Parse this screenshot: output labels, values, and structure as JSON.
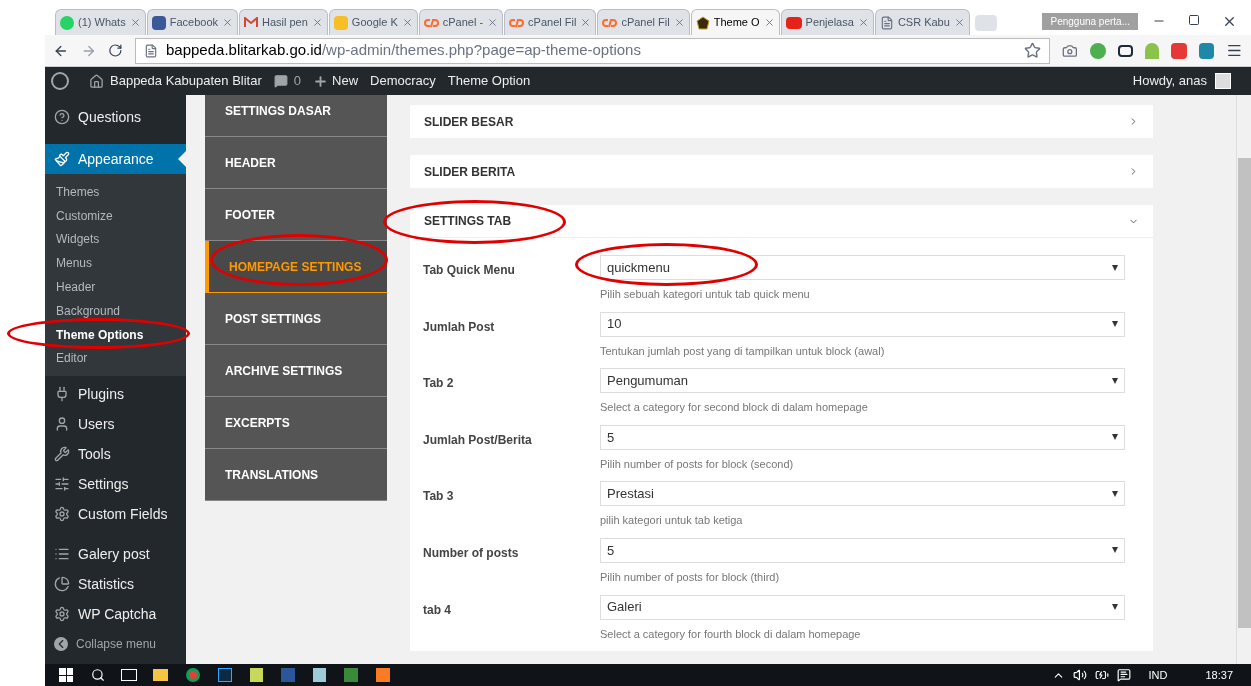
{
  "browser": {
    "tabs": [
      {
        "title": "(1) Whats",
        "selected": false
      },
      {
        "title": "Facebook",
        "selected": false
      },
      {
        "title": "Hasil pen",
        "selected": false
      },
      {
        "title": "Google K",
        "selected": false
      },
      {
        "title": "cPanel - ",
        "selected": false
      },
      {
        "title": "cPanel Fil",
        "selected": false
      },
      {
        "title": "cPanel Fil",
        "selected": false
      },
      {
        "title": "Theme O",
        "selected": true
      },
      {
        "title": "Penjelasa",
        "selected": false
      },
      {
        "title": "CSR Kabu",
        "selected": false
      }
    ],
    "profile": "Pengguna perta...",
    "url": {
      "domain": "bappeda.blitarkab.go.id",
      "path": "/wp-admin/themes.php?page=ap-theme-options"
    }
  },
  "admin_bar": {
    "site": "Bappeda Kabupaten Blitar",
    "comments": "0",
    "new": "New",
    "links": [
      "Democracy",
      "Theme Option"
    ],
    "greeting": "Howdy, anas"
  },
  "sidebar": {
    "items": [
      {
        "label": "Questions",
        "selected": false
      },
      {
        "label": "Appearance",
        "selected": true,
        "children": [
          {
            "label": "Themes",
            "selected": false
          },
          {
            "label": "Customize",
            "selected": false
          },
          {
            "label": "Widgets",
            "selected": false
          },
          {
            "label": "Menus",
            "selected": false
          },
          {
            "label": "Header",
            "selected": false
          },
          {
            "label": "Background",
            "selected": false
          },
          {
            "label": "Theme Options",
            "selected": true
          },
          {
            "label": "Editor",
            "selected": false
          }
        ]
      },
      {
        "label": "Plugins",
        "selected": false
      },
      {
        "label": "Users",
        "selected": false
      },
      {
        "label": "Tools",
        "selected": false
      },
      {
        "label": "Settings",
        "selected": false
      },
      {
        "label": "Custom Fields",
        "selected": false
      },
      {
        "label": "Galery post",
        "selected": false
      },
      {
        "label": "Statistics",
        "selected": false
      },
      {
        "label": "WP Captcha",
        "selected": false
      }
    ],
    "collapse": "Collapse menu"
  },
  "options_nav": [
    {
      "label": "SETTINGS DASAR",
      "selected": false
    },
    {
      "label": "HEADER",
      "selected": false
    },
    {
      "label": "FOOTER",
      "selected": false
    },
    {
      "label": "HOMEPAGE SETTINGS",
      "selected": true
    },
    {
      "label": "POST SETTINGS",
      "selected": false
    },
    {
      "label": "ARCHIVE SETTINGS",
      "selected": false
    },
    {
      "label": "EXCERPTS",
      "selected": false
    },
    {
      "label": "TRANSLATIONS",
      "selected": false
    }
  ],
  "sections": [
    {
      "title": "SLIDER BESAR",
      "expanded": false
    },
    {
      "title": "SLIDER BERITA",
      "expanded": false
    },
    {
      "title": "SETTINGS TAB",
      "expanded": true,
      "fields": [
        {
          "label": "Tab Quick Menu",
          "value": "quickmenu",
          "help": "Pilih sebuah kategori untuk tab quick menu"
        },
        {
          "label": "Jumlah Post",
          "value": "10",
          "help": "Tentukan jumlah post yang di tampilkan untuk block (awal)"
        },
        {
          "label": "Tab 2",
          "value": "Pengumuman",
          "help": "Select a category for second block di dalam homepage"
        },
        {
          "label": "Jumlah Post/Berita",
          "value": "5",
          "help": "Pilih number of posts for block (second)"
        },
        {
          "label": "Tab 3",
          "value": "Prestasi",
          "help": "pilih kategori untuk tab ketiga"
        },
        {
          "label": "Number of posts",
          "value": "5",
          "help": "Pilih number of posts for block (third)"
        },
        {
          "label": "tab 4",
          "value": "Galeri",
          "help": "Select a category for fourth block di dalam homepage"
        }
      ]
    }
  ],
  "taskbar": {
    "language": "IND",
    "time": "18:37"
  }
}
